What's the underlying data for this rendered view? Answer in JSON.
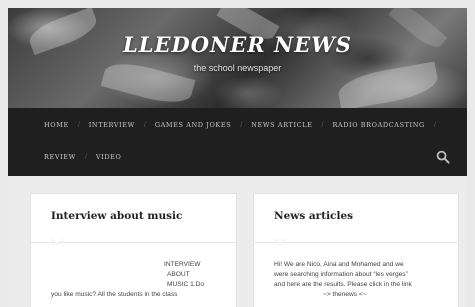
{
  "header": {
    "site_title": "LLEDONER NEWS",
    "site_description": "the school newspaper"
  },
  "nav": {
    "items_row1": [
      "HOME",
      "INTERVIEW",
      "GAMES AND JOKES",
      "NEWS ARTICLE",
      "RADIO BROADCASTING"
    ],
    "items_row2": [
      "REVIEW",
      "VIDEO"
    ],
    "search_icon": "search-icon"
  },
  "posts": {
    "left": {
      "title": "Interview about music",
      "lines": [
        "INTERVIEW",
        "ABOUT",
        "MUSIC  1.Do",
        "you like music? All the students in the class"
      ]
    },
    "right": {
      "title": "News articles",
      "lines": [
        "Hi! We are Nico, Aina and Mohamed  and we",
        "were searching information about “les verges”",
        "and here are the results. Please click in the link",
        "~> thenews <~"
      ]
    }
  }
}
